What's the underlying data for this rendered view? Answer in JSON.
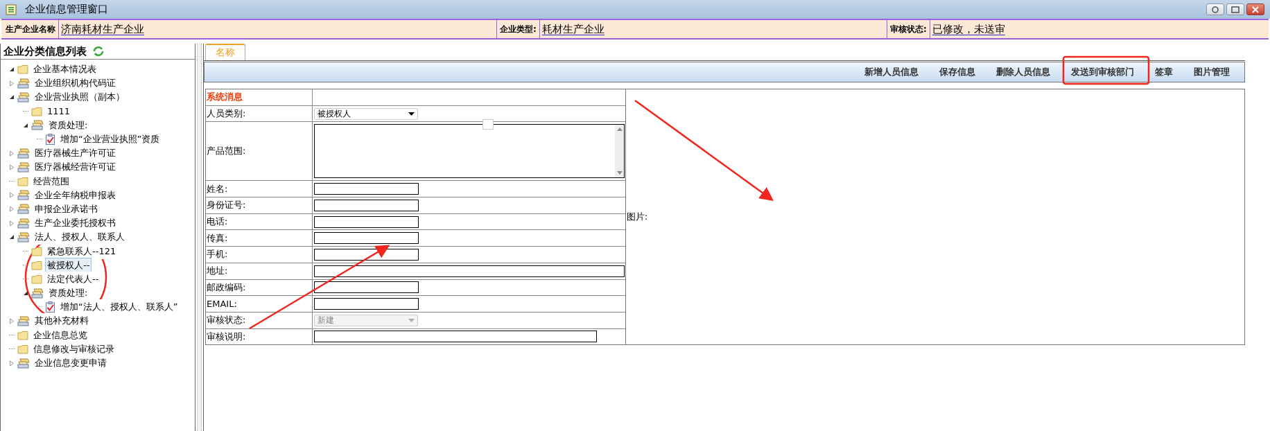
{
  "window": {
    "title": "企业信息管理窗口"
  },
  "header": [
    {
      "label": "生产企业名称",
      "value": "济南耗材生产企业"
    },
    {
      "label": "企业类型:",
      "value": "耗材生产企业"
    },
    {
      "label": "审核状态:",
      "value": "已修改，未送审"
    }
  ],
  "sidebar": {
    "title": "企业分类信息列表",
    "tree": [
      {
        "label": "企业基本情况表",
        "kind": "folder",
        "expanded": true,
        "selected": false
      },
      {
        "label": "企业组织机构代码证",
        "kind": "stack",
        "expanded": false,
        "selected": false
      },
      {
        "label": "企业营业执照（副本）",
        "kind": "stack",
        "expanded": true,
        "selected": false,
        "children": [
          {
            "label": "1111",
            "kind": "folder",
            "selected": false
          },
          {
            "label": "资质处理:",
            "kind": "stack",
            "expanded": true,
            "selected": false,
            "children": [
              {
                "label": "增加“企业营业执照”资质",
                "kind": "clipboard",
                "selected": false
              }
            ]
          }
        ]
      },
      {
        "label": "医疗器械生产许可证",
        "kind": "stack",
        "expanded": false,
        "selected": false
      },
      {
        "label": "医疗器械经营许可证",
        "kind": "stack",
        "expanded": false,
        "selected": false
      },
      {
        "label": "经营范围",
        "kind": "folder",
        "selected": false
      },
      {
        "label": "企业全年纳税申报表",
        "kind": "stack",
        "expanded": false,
        "selected": false
      },
      {
        "label": "申报企业承诺书",
        "kind": "stack",
        "expanded": false,
        "selected": false
      },
      {
        "label": "生产企业委托授权书",
        "kind": "stack",
        "expanded": false,
        "selected": false
      },
      {
        "label": "法人、授权人、联系人",
        "kind": "stack",
        "expanded": true,
        "selected": false,
        "children": [
          {
            "label": "紧急联系人--121",
            "kind": "folder",
            "selected": false
          },
          {
            "label": "被授权人--",
            "kind": "folder",
            "selected": true
          },
          {
            "label": "法定代表人--",
            "kind": "folder",
            "selected": false
          },
          {
            "label": "资质处理:",
            "kind": "stack",
            "expanded": true,
            "selected": false,
            "children": [
              {
                "label": "增加“法人、授权人、联系人”",
                "kind": "clipboard",
                "selected": false
              }
            ]
          }
        ]
      },
      {
        "label": "其他补充材料",
        "kind": "stack",
        "expanded": false,
        "selected": false
      },
      {
        "label": "企业信息总览",
        "kind": "folder",
        "selected": false
      },
      {
        "label": "信息修改与审核记录",
        "kind": "folder",
        "selected": false
      },
      {
        "label": "企业信息变更申请",
        "kind": "stack",
        "expanded": false,
        "selected": false
      }
    ]
  },
  "tabs": [
    {
      "label": "名称",
      "selected": true
    }
  ],
  "toolbar": [
    "新增人员信息",
    "保存信息",
    "删除人员信息",
    "发送到审核部门",
    "签章",
    "图片管理"
  ],
  "form": {
    "rows": [
      {
        "kind": "heading",
        "label": "系统消息"
      },
      {
        "kind": "select",
        "label": "人员类别:",
        "value": "被授权人",
        "disabled": false
      },
      {
        "kind": "textarea",
        "label": "产品范围:"
      },
      {
        "kind": "input",
        "label": "姓名:"
      },
      {
        "kind": "input",
        "label": "身份证号:"
      },
      {
        "kind": "input",
        "label": "电话:"
      },
      {
        "kind": "input",
        "label": "传真:"
      },
      {
        "kind": "input",
        "label": "手机:"
      },
      {
        "kind": "wide",
        "label": "地址:"
      },
      {
        "kind": "input",
        "label": "邮政编码:"
      },
      {
        "kind": "input",
        "label": "EMAIL:"
      },
      {
        "kind": "select",
        "label": "审核状态:",
        "value": "新建",
        "disabled": true
      },
      {
        "kind": "long",
        "label": "审核说明:"
      }
    ],
    "image_label": "图片:"
  }
}
